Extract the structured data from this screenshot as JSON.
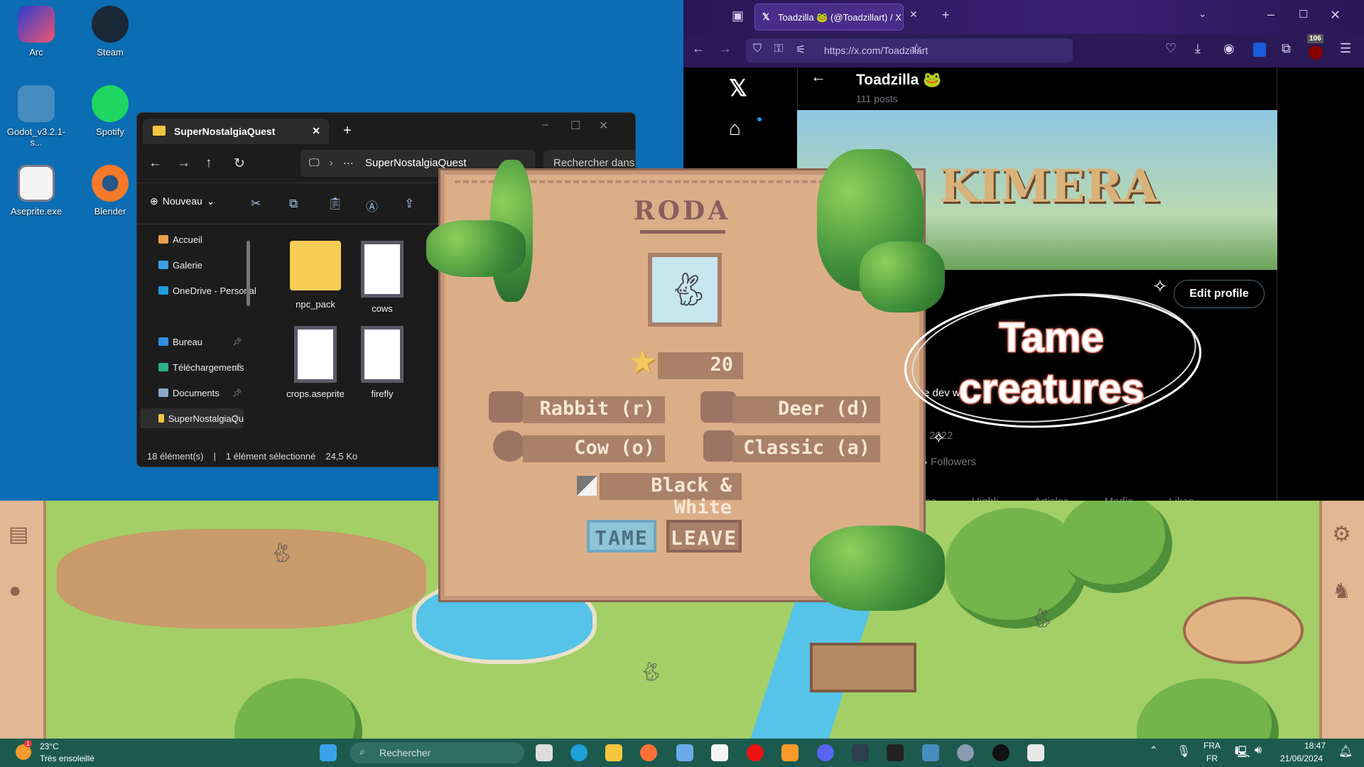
{
  "desktop": {
    "icons": [
      {
        "label": "Arc",
        "icon": "arc-icon"
      },
      {
        "label": "Steam",
        "icon": "steam-icon"
      },
      {
        "label": "Godot_v3.2.1-s...",
        "icon": "godot-icon"
      },
      {
        "label": "Spotify",
        "icon": "spotify-icon"
      },
      {
        "label": "Aseprite.exe",
        "icon": "aseprite-icon"
      },
      {
        "label": "Blender",
        "icon": "blender-icon"
      }
    ]
  },
  "explorer": {
    "tab_title": "SuperNostalgiaQuest",
    "path_current": "SuperNostalgiaQuest",
    "path_ellipsis": "···",
    "search_placeholder": "Rechercher dans",
    "new_label": "Nouveau",
    "sidebar": [
      {
        "label": "Accueil"
      },
      {
        "label": "Galerie"
      },
      {
        "label": "OneDrive - Personal"
      },
      {
        "label": "Bureau"
      },
      {
        "label": "Téléchargements"
      },
      {
        "label": "Documents"
      },
      {
        "label": "SuperNostalgiaQu"
      }
    ],
    "files": [
      {
        "name": "npc_pack",
        "type": "folder"
      },
      {
        "name": "cows",
        "type": "file"
      },
      {
        "name": "crops.aseprite",
        "type": "file"
      },
      {
        "name": "firefly",
        "type": "file"
      }
    ],
    "status": {
      "count": "18 élément(s)",
      "selected": "1 élément sélectionné",
      "size": "24,5 Ko"
    }
  },
  "browser": {
    "tab_title": "Toadzilla 🐸 (@Toadzillart) / X",
    "url": "https://x.com/Toadzillart",
    "badge_count": "106",
    "profile": {
      "name": "Toadzilla 🐸",
      "posts": "111 posts",
      "edit_label": "Edit profile",
      "bio_fragment": "e dev w",
      "joined_fragment": "2022",
      "followers_label": "Followers",
      "followers_fragment": "5",
      "tabs": [
        "es",
        "Highli",
        "Articles",
        "Media",
        "Likes"
      ],
      "banner_text": "KIMERA"
    }
  },
  "overlay": {
    "line1": "Tame",
    "line2": "creatures",
    "text_color": "#ffffff",
    "outline_color": "#f08878"
  },
  "game": {
    "dialog": {
      "creature_name": "RODA",
      "level": "20",
      "traits": [
        {
          "label": "Rabbit (r)",
          "icon": "rabbit-trait-icon"
        },
        {
          "label": "Deer (d)",
          "icon": "deer-trait-icon"
        },
        {
          "label": "Cow (o)",
          "icon": "cow-trait-icon"
        },
        {
          "label": "Classic (a)",
          "icon": "classic-trait-icon"
        },
        {
          "label": "Black & White",
          "icon": "color-swatch-icon"
        }
      ],
      "tame_label": "TAME",
      "leave_label": "LEAVE",
      "colors": {
        "panel": "#dcae88",
        "bar": "#a98068",
        "tame": "#8fc3d8"
      }
    }
  },
  "taskbar": {
    "weather_temp": "23°C",
    "weather_desc": "Très ensoleillé",
    "search_placeholder": "Rechercher",
    "lang1": "FRA",
    "lang2": "FR",
    "time": "18:47",
    "date": "21/06/2024",
    "notif_badge": "1"
  }
}
